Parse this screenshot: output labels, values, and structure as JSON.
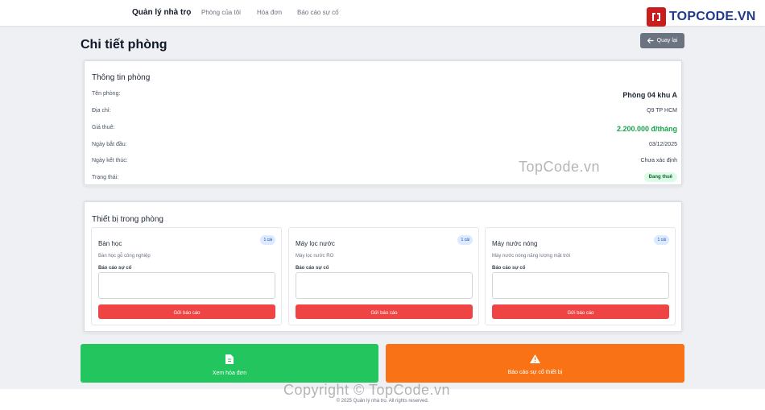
{
  "nav": {
    "brand": "Quản lý nhà trọ",
    "links": [
      "Phòng của tôi",
      "Hóa đơn",
      "Báo cáo sự cố"
    ]
  },
  "logo": {
    "text": "TOPCODE.VN"
  },
  "page": {
    "title": "Chi tiết phòng",
    "back_label": "Quay lại"
  },
  "room_info": {
    "title": "Thông tin phòng",
    "rows": [
      {
        "label": "Tên phòng:",
        "value": "Phòng 04 khu A"
      },
      {
        "label": "Địa chỉ:",
        "value": "Q9 TP HCM"
      },
      {
        "label": "Giá thuê:",
        "value": "2.200.000 đ/tháng"
      },
      {
        "label": "Ngày bắt đầu:",
        "value": "03/12/2025"
      },
      {
        "label": "Ngày kết thúc:",
        "value": "Chưa xác định"
      },
      {
        "label": "Trạng thái:",
        "value": "Đang thuê"
      }
    ]
  },
  "devices": {
    "title": "Thiết bị trong phòng",
    "items": [
      {
        "name": "Bàn học",
        "qty": "1 cái",
        "desc": "Bàn học gỗ công nghiệp",
        "report_label": "Báo cáo sự cố",
        "button": "Gửi báo cáo"
      },
      {
        "name": "Máy lọc nước",
        "qty": "1 cái",
        "desc": "Máy lọc nước RO",
        "report_label": "Báo cáo sự cố",
        "button": "Gửi báo cáo"
      },
      {
        "name": "Máy nước nóng",
        "qty": "1 cái",
        "desc": "Máy nước nóng năng lượng mặt trời",
        "report_label": "Báo cáo sự cố",
        "button": "Gửi báo cáo"
      }
    ]
  },
  "actions": {
    "invoice": "Xem hóa đơn",
    "report": "Báo cáo sự cố thiết bị"
  },
  "footer": {
    "text": "© 2025 Quản lý nhà trọ. All rights reserved."
  },
  "watermarks": {
    "mid": "TopCode.vn",
    "bottom": "Copyright © TopCode.vn"
  },
  "colors": {
    "success": "#22c55e",
    "warning": "#f97316",
    "danger": "#ef4444",
    "price": "#16a34a",
    "secondary": "#6b7280"
  }
}
